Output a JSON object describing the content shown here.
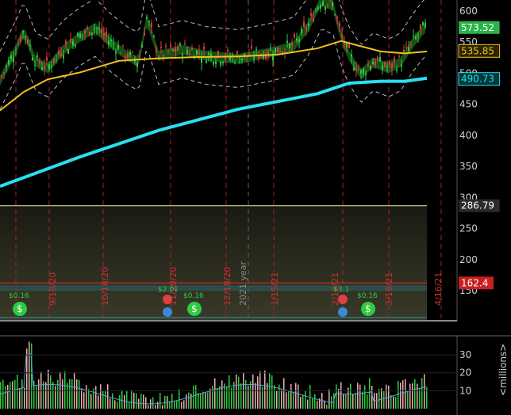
{
  "chart_data": [
    {
      "type": "line",
      "panel": "price",
      "title": "",
      "xlabel": "",
      "ylabel": "",
      "y_ticks": [
        150,
        200,
        250,
        300,
        350,
        400,
        450,
        500,
        550,
        600
      ],
      "ylim": [
        130,
        615
      ],
      "price_labels": [
        {
          "name": "last-price",
          "text": "573.52",
          "value": 573.52,
          "color": "#2bb34a",
          "text_color": "#ffffff"
        },
        {
          "name": "ma-50",
          "text": "535.85",
          "value": 535.85,
          "color": "#2b2400",
          "text_color": "#f0c020"
        },
        {
          "name": "ma-200",
          "text": "490.73",
          "value": 490.73,
          "color": "#003838",
          "text_color": "#28e0f0"
        },
        {
          "name": "horizontal-line-high",
          "text": "286.79",
          "value": 286.79,
          "color": "#2a2a2a",
          "text_color": "#ffffff"
        },
        {
          "name": "horizontal-line-low",
          "text": "162.4",
          "value": 162.4,
          "color": "#c82020",
          "text_color": "#ffffff"
        }
      ],
      "series": [
        {
          "key": "ma200",
          "color": "#28e0f0",
          "x": [
            0,
            100,
            200,
            300,
            400,
            440,
            480,
            510,
            538
          ],
          "values": [
            318,
            365,
            408,
            442,
            467,
            484,
            487,
            487,
            492
          ]
        },
        {
          "key": "ma50",
          "color": "#f0c020",
          "x": [
            0,
            30,
            60,
            100,
            150,
            200,
            250,
            300,
            350,
            400,
            430,
            450,
            480,
            510,
            538
          ],
          "values": [
            440,
            470,
            490,
            501,
            520,
            524,
            526,
            527,
            530,
            540,
            552,
            545,
            535,
            532,
            535
          ]
        },
        {
          "key": "price",
          "color": "#2ecc40",
          "x": [
            0,
            20,
            30,
            45,
            60,
            80,
            100,
            120,
            140,
            160,
            175,
            185,
            200,
            230,
            260,
            300,
            340,
            370,
            390,
            405,
            420,
            430,
            440,
            455,
            470,
            490,
            505,
            520,
            535
          ],
          "values": [
            490,
            540,
            570,
            520,
            510,
            540,
            560,
            575,
            550,
            530,
            520,
            590,
            530,
            540,
            530,
            525,
            535,
            545,
            580,
            620,
            610,
            560,
            530,
            500,
            520,
            510,
            520,
            550,
            575
          ]
        }
      ],
      "dates": [
        "9/18/20",
        "10/16/20",
        "11/20/20",
        "12/18/20",
        "1/15/21",
        "2/19/21",
        "3/19/21",
        "4/16/21"
      ],
      "year_label": "2021 year",
      "events": [
        {
          "kind": "earnings",
          "value": "$2.01"
        },
        {
          "kind": "earnings",
          "value": "$3.1"
        },
        {
          "kind": "dividend",
          "value": "$0.16"
        },
        {
          "kind": "dividend",
          "value": "$0.16"
        },
        {
          "kind": "dividend",
          "value": "$0.16"
        }
      ]
    },
    {
      "type": "bar",
      "panel": "volume",
      "ylabel": "<millions>",
      "y_ticks": [
        10,
        20,
        30
      ],
      "ylim": [
        0,
        38
      ]
    }
  ]
}
